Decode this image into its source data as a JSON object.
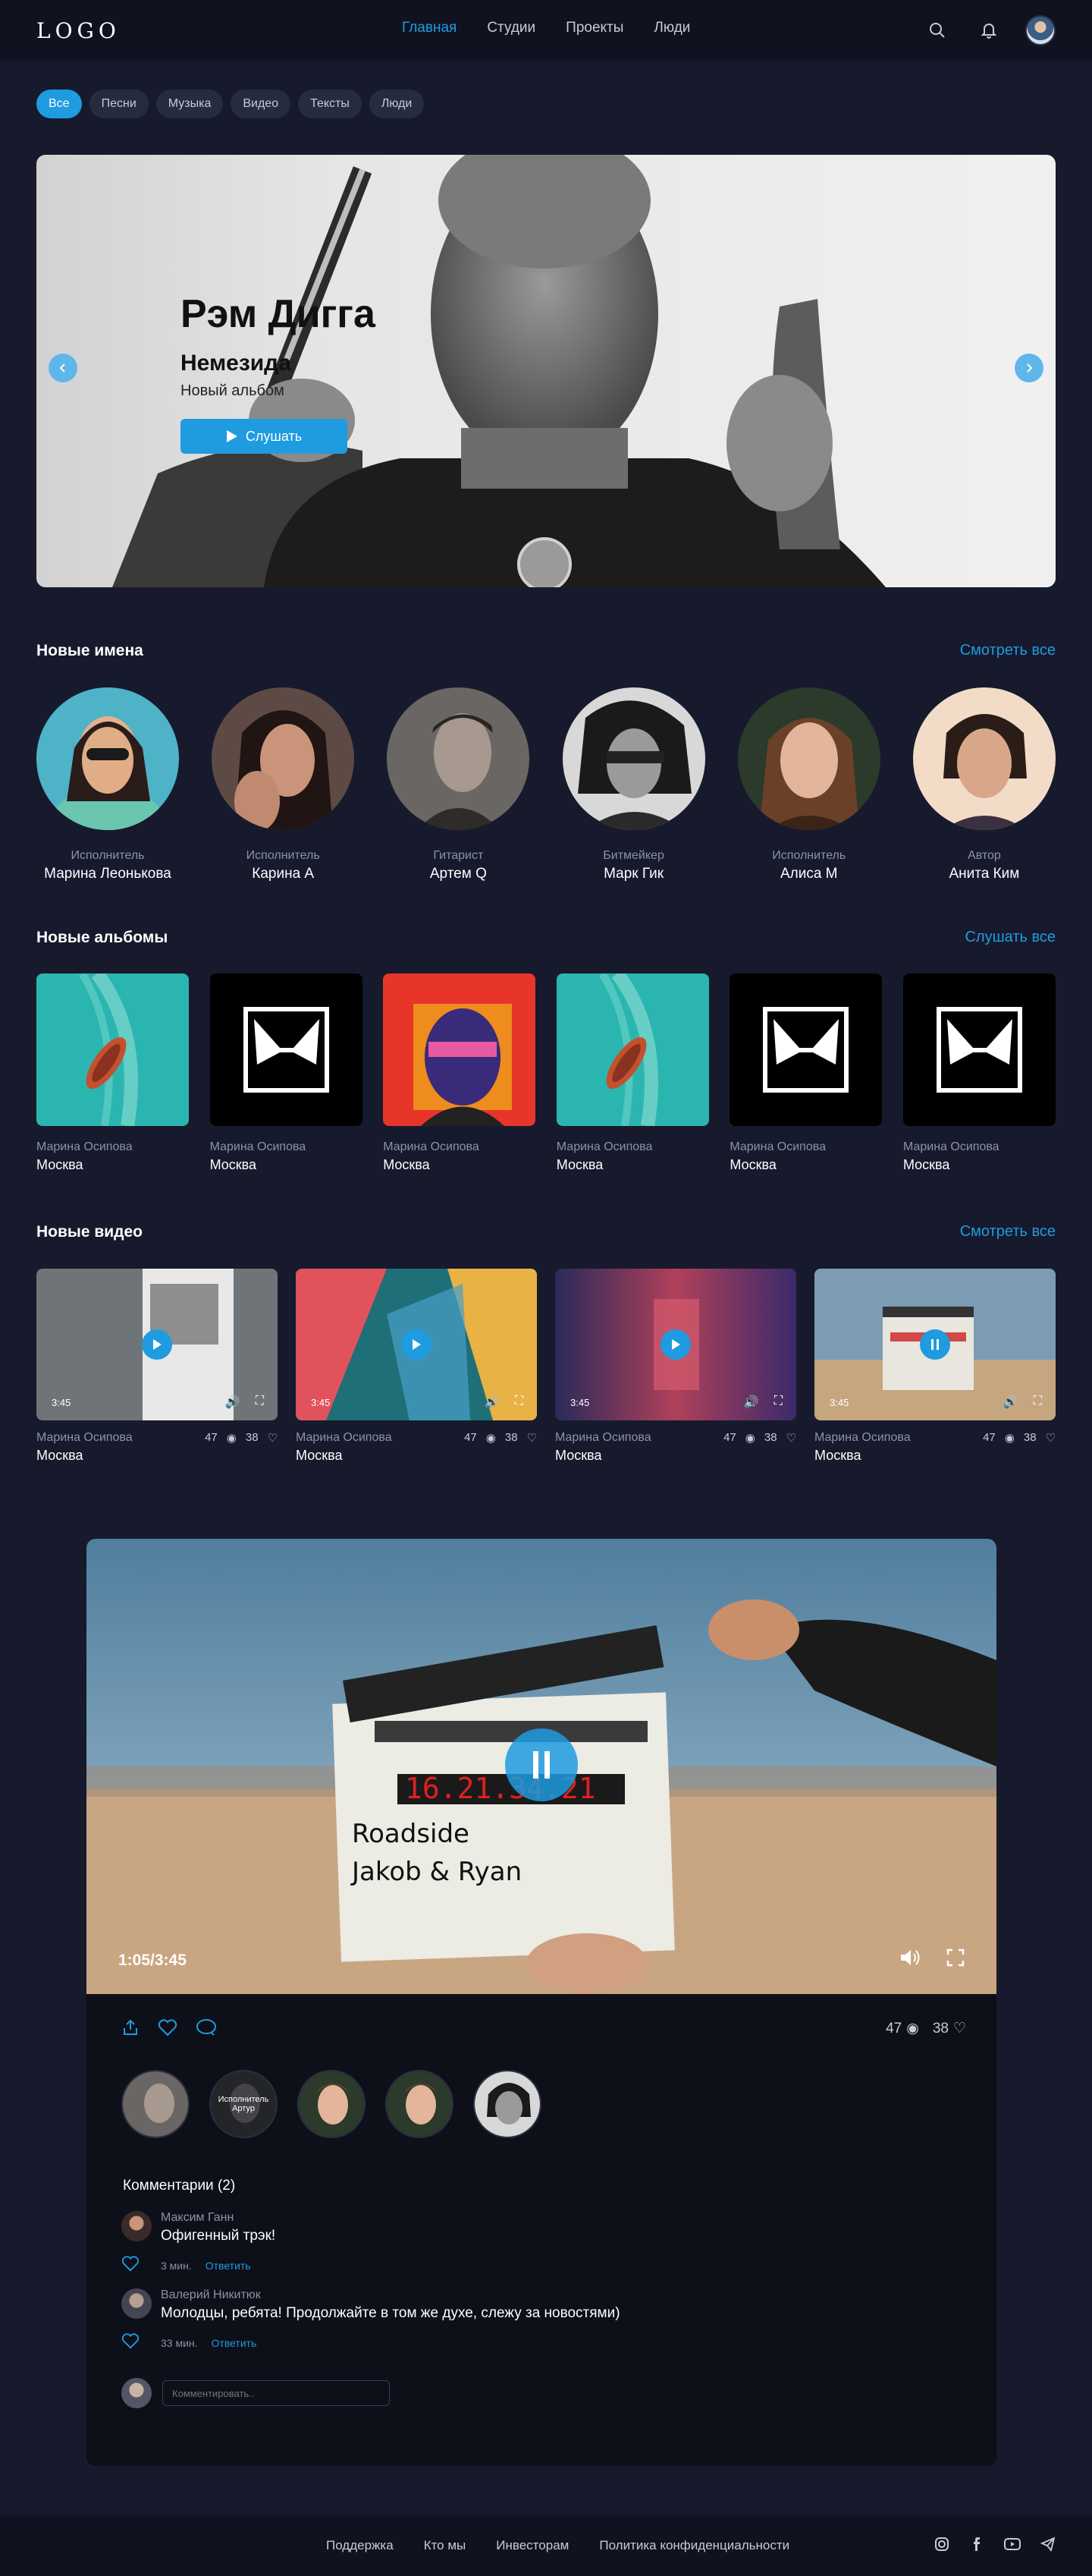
{
  "header": {
    "logo": "LOGO",
    "nav": [
      "Главная",
      "Студии",
      "Проекты",
      "Люди"
    ]
  },
  "filters": [
    "Все",
    "Песни",
    "Музыка",
    "Видео",
    "Тексты",
    "Люди"
  ],
  "hero": {
    "artist": "Рэм Дигга",
    "album": "Немезида",
    "subtitle": "Новый альбом",
    "button": "Слушать"
  },
  "new_names": {
    "title": "Новые имена",
    "link": "Смотреть все",
    "people": [
      {
        "role": "Исполнитель",
        "name": "Марина Леонькова"
      },
      {
        "role": "Исполнитель",
        "name": "Карина А"
      },
      {
        "role": "Гитарист",
        "name": "Артем Q"
      },
      {
        "role": "Битмейкер",
        "name": "Марк Гик"
      },
      {
        "role": "Исполнитель",
        "name": "Алиса М"
      },
      {
        "role": "Автор",
        "name": "Анита Ким"
      }
    ]
  },
  "new_albums": {
    "title": "Новые альбомы",
    "link": "Слушать все",
    "items": [
      {
        "artist": "Марина Осипова",
        "city": "Москва"
      },
      {
        "artist": "Марина Осипова",
        "city": "Москва"
      },
      {
        "artist": "Марина Осипова",
        "city": "Москва"
      },
      {
        "artist": "Марина Осипова",
        "city": "Москва"
      },
      {
        "artist": "Марина Осипова",
        "city": "Москва"
      },
      {
        "artist": "Марина Осипова",
        "city": "Москва"
      }
    ]
  },
  "new_videos": {
    "title": "Новые видео",
    "link": "Смотреть все",
    "items": [
      {
        "duration": "3:45",
        "artist": "Марина Осипова",
        "city": "Москва",
        "views": "47",
        "likes": "38"
      },
      {
        "duration": "3:45",
        "artist": "Марина Осипова",
        "city": "Москва",
        "views": "47",
        "likes": "38"
      },
      {
        "duration": "3:45",
        "artist": "Марина Осипова",
        "city": "Москва",
        "views": "47",
        "likes": "38"
      },
      {
        "duration": "3:45",
        "artist": "Марина Осипова",
        "city": "Москва",
        "views": "47",
        "likes": "38"
      }
    ]
  },
  "player": {
    "time": "1:05/3:45",
    "views": "47",
    "likes": "38",
    "hover_role": "Исполнитель",
    "hover_name": "Артур",
    "comments_title": "Комментарии (2)",
    "comments": [
      {
        "author": "Максим Ганн",
        "text": "Офигенный трэк!",
        "ago": "3 мин.",
        "reply": "Ответить"
      },
      {
        "author": "Валерий Никитюк",
        "text": "Молодцы, ребята! Продолжайте в том же духе, слежу за новостями)",
        "ago": "33 мин.",
        "reply": "Ответить"
      }
    ],
    "comment_placeholder": "Комментировать.."
  },
  "footer": {
    "links": [
      "Поддержка",
      "Кто мы",
      "Инвесторам",
      "Политика конфиденциальности"
    ]
  },
  "colors": {
    "accent": "#1f9be0",
    "bg": "#161a2c",
    "bar": "#10131f"
  }
}
